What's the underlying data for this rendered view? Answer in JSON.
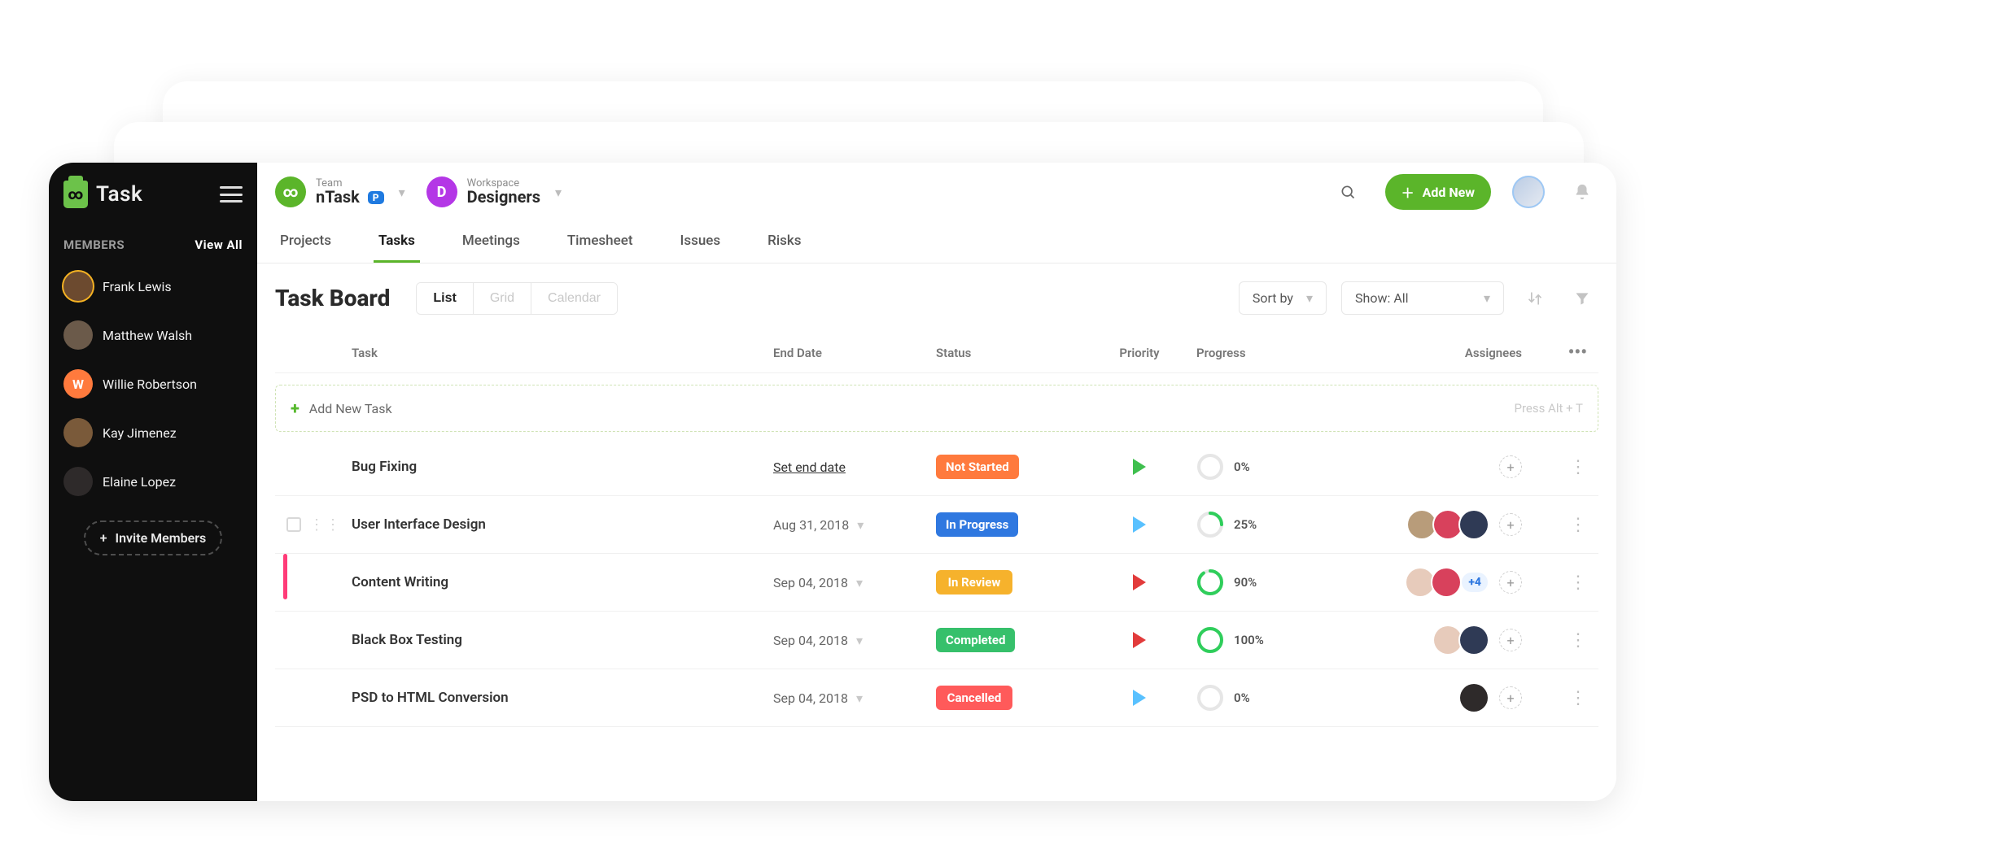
{
  "app": {
    "logo_text": "Task"
  },
  "sidebar": {
    "members_label": "MEMBERS",
    "view_all": "View All",
    "members": [
      {
        "name": "Frank Lewis",
        "avatar_bg": "#6c4a2f",
        "initial": "",
        "ring": true
      },
      {
        "name": "Matthew Walsh",
        "avatar_bg": "#6b5a4a",
        "initial": ""
      },
      {
        "name": "Willie Robertson",
        "avatar_bg": "#ff7a3d",
        "initial": "W"
      },
      {
        "name": "Kay Jimenez",
        "avatar_bg": "#7a5a3a",
        "initial": ""
      },
      {
        "name": "Elaine Lopez",
        "avatar_bg": "#2e2a2a",
        "initial": ""
      }
    ],
    "invite_label": "Invite Members"
  },
  "header": {
    "team_label": "Team",
    "team_name": "nTask",
    "team_badge": "P",
    "workspace_label": "Workspace",
    "workspace_name": "Designers",
    "add_new": "Add New"
  },
  "tabs": [
    {
      "label": "Projects",
      "active": false
    },
    {
      "label": "Tasks",
      "active": true
    },
    {
      "label": "Meetings",
      "active": false
    },
    {
      "label": "Timesheet",
      "active": false
    },
    {
      "label": "Issues",
      "active": false
    },
    {
      "label": "Risks",
      "active": false
    }
  ],
  "board": {
    "title": "Task Board",
    "view_modes": {
      "list": "List",
      "grid": "Grid",
      "calendar": "Calendar"
    },
    "sort_by_label": "Sort by",
    "show_prefix": "Show:",
    "show_value": "All",
    "add_task_label": "Add New Task",
    "add_task_hint": "Press Alt + T"
  },
  "columns": {
    "task": "Task",
    "end_date": "End Date",
    "status": "Status",
    "priority": "Priority",
    "progress": "Progress",
    "assignees": "Assignees"
  },
  "rows": [
    {
      "name": "Bug Fixing",
      "end_date": "Set end date",
      "end_date_is_action": true,
      "status": "Not Started",
      "status_class": "pill-notstarted",
      "priority": "green",
      "progress_pct": 0,
      "progress_color": "#d9d9d9",
      "assignees": [],
      "extra": null,
      "accent": false
    },
    {
      "name": "User Interface Design",
      "end_date": "Aug 31, 2018",
      "status": "In Progress",
      "status_class": "pill-inprogress",
      "priority": "blue",
      "progress_pct": 25,
      "progress_color": "#2fce5b",
      "assignees": [
        {
          "bg": "#b89c7a"
        },
        {
          "bg": "#d8415c"
        },
        {
          "bg": "#2f3a55"
        }
      ],
      "extra": null,
      "accent": false,
      "show_drag": true
    },
    {
      "name": "Content Writing",
      "end_date": "Sep 04, 2018",
      "status": "In Review",
      "status_class": "pill-inreview",
      "priority": "red",
      "progress_pct": 90,
      "progress_color": "#2fce5b",
      "assignees": [
        {
          "bg": "#e7cbbb"
        },
        {
          "bg": "#d8415c"
        }
      ],
      "extra": "+4",
      "accent": true
    },
    {
      "name": "Black Box Testing",
      "end_date": "Sep 04, 2018",
      "status": "Completed",
      "status_class": "pill-completed",
      "priority": "red",
      "progress_pct": 100,
      "progress_color": "#2fce5b",
      "assignees": [
        {
          "bg": "#e7cbbb"
        },
        {
          "bg": "#2f3a55"
        }
      ],
      "extra": null,
      "accent": false
    },
    {
      "name": "PSD to HTML Conversion",
      "end_date": "Sep 04, 2018",
      "status": "Cancelled",
      "status_class": "pill-cancelled",
      "priority": "blue",
      "progress_pct": 0,
      "progress_color": "#d9d9d9",
      "assignees": [
        {
          "bg": "#2e2a2a"
        }
      ],
      "extra": null,
      "accent": false
    }
  ]
}
